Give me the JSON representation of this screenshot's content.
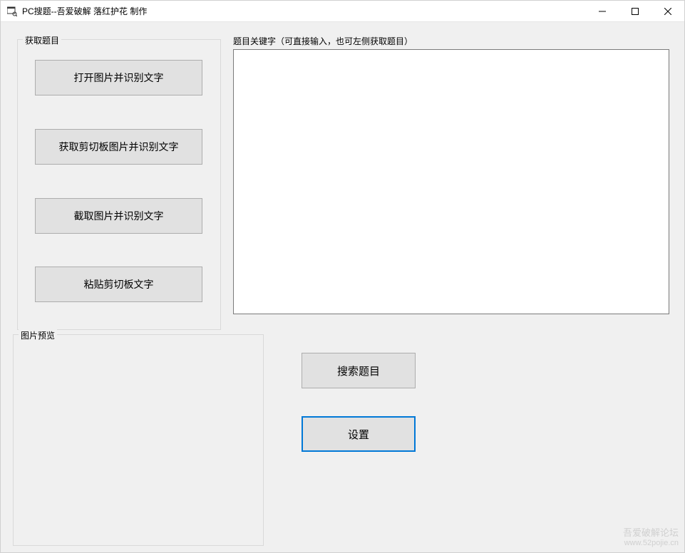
{
  "window": {
    "title": "PC搜题--吾爱破解 落红护花 制作"
  },
  "groups": {
    "acquire": "获取题目",
    "preview": "图片预览"
  },
  "buttons": {
    "open_image_ocr": "打开图片并识别文字",
    "clipboard_image_ocr": "获取剪切板图片并识别文字",
    "screenshot_ocr": "截取图片并识别文字",
    "paste_clipboard_text": "粘贴剪切板文字",
    "search": "搜索题目",
    "settings": "设置"
  },
  "keyword": {
    "label": "题目关键字（可直接输入，也可左侧获取题目）",
    "value": ""
  },
  "watermark": {
    "line1": "吾爱破解论坛",
    "line2": "www.52pojie.cn"
  }
}
